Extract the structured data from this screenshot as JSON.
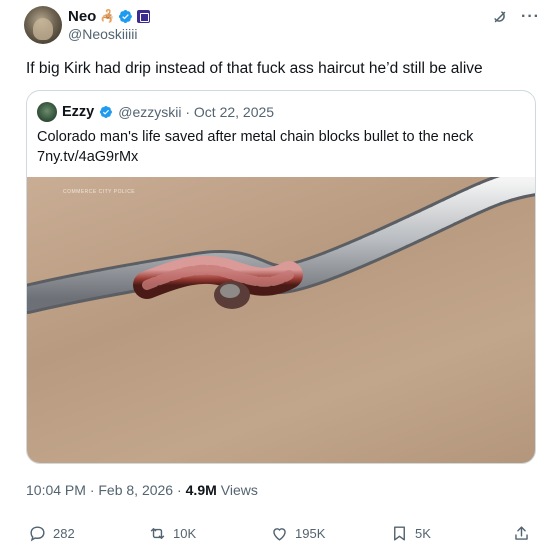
{
  "author": {
    "display_name": "Neo",
    "name_emoji": "🦂",
    "handle": "@Neoskiiiii"
  },
  "tweet": {
    "text": "If big Kirk had drip instead of that fuck ass haircut he’d still be alive",
    "timestamp": "10:04 PM · Feb 8, 2026 ·",
    "views_count": "4.9M",
    "views_label": "Views"
  },
  "quoted": {
    "display_name": "Ezzy",
    "meta": "@ezzyskii · Oct 22, 2025",
    "text": "Colorado man's life saved after metal chain blocks bullet to the neck",
    "link": "7ny.tv/4aG9rMx",
    "image_watermark": "COMMERCE CITY POLICE"
  },
  "actions": {
    "replies": "282",
    "reposts": "10K",
    "likes": "195K",
    "bookmarks": "5K"
  },
  "colors": {
    "verified_blue": "#1d9bf0",
    "muted_text": "#536471",
    "primary_text": "#0f1419",
    "border": "#cfd9de"
  },
  "icons": [
    "grok-icon",
    "more-icon",
    "verified-badge-icon",
    "affiliate-badge-icon",
    "reply-icon",
    "repost-icon",
    "like-icon",
    "bookmark-icon",
    "share-icon"
  ]
}
